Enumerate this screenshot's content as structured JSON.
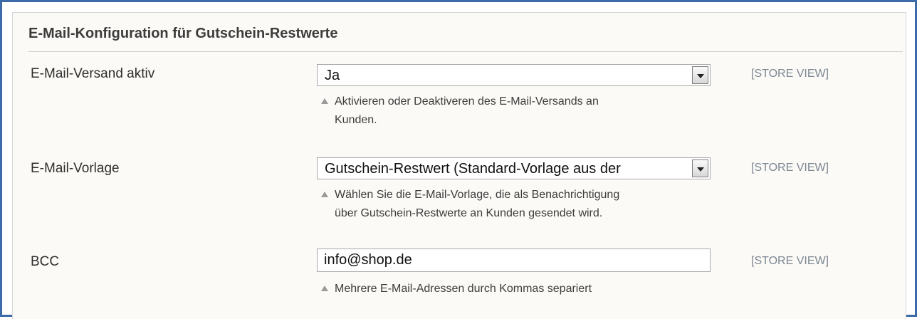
{
  "section": {
    "title": "E-Mail-Konfiguration für Gutschein-Restwerte"
  },
  "rows": [
    {
      "label": "E-Mail-Versand aktiv",
      "control": "select",
      "value": "Ja",
      "scope": "[STORE VIEW]",
      "hint_line1": "Aktivieren oder Deaktiveren des E-Mail-Versands an",
      "hint_line2": "Kunden."
    },
    {
      "label": "E-Mail-Vorlage",
      "control": "select",
      "value": "Gutschein-Restwert (Standard-Vorlage aus der",
      "scope": "[STORE VIEW]",
      "hint_line1": "Wählen Sie die E-Mail-Vorlage, die als Benachrichtigung",
      "hint_line2": "über Gutschein-Restwerte an Kunden gesendet wird."
    },
    {
      "label": "BCC",
      "control": "text",
      "value": "info@shop.de",
      "scope": "[STORE VIEW]",
      "hint_line1": "Mehrere E-Mail-Adressen durch Kommas separiert"
    }
  ],
  "icons": {
    "dropdown": "chevron-down-icon",
    "hint": "triangle-up-icon"
  },
  "colors": {
    "frame_border": "#3d6aa8",
    "panel_background": "#fbfaf6",
    "scope_text": "#7d8793"
  }
}
